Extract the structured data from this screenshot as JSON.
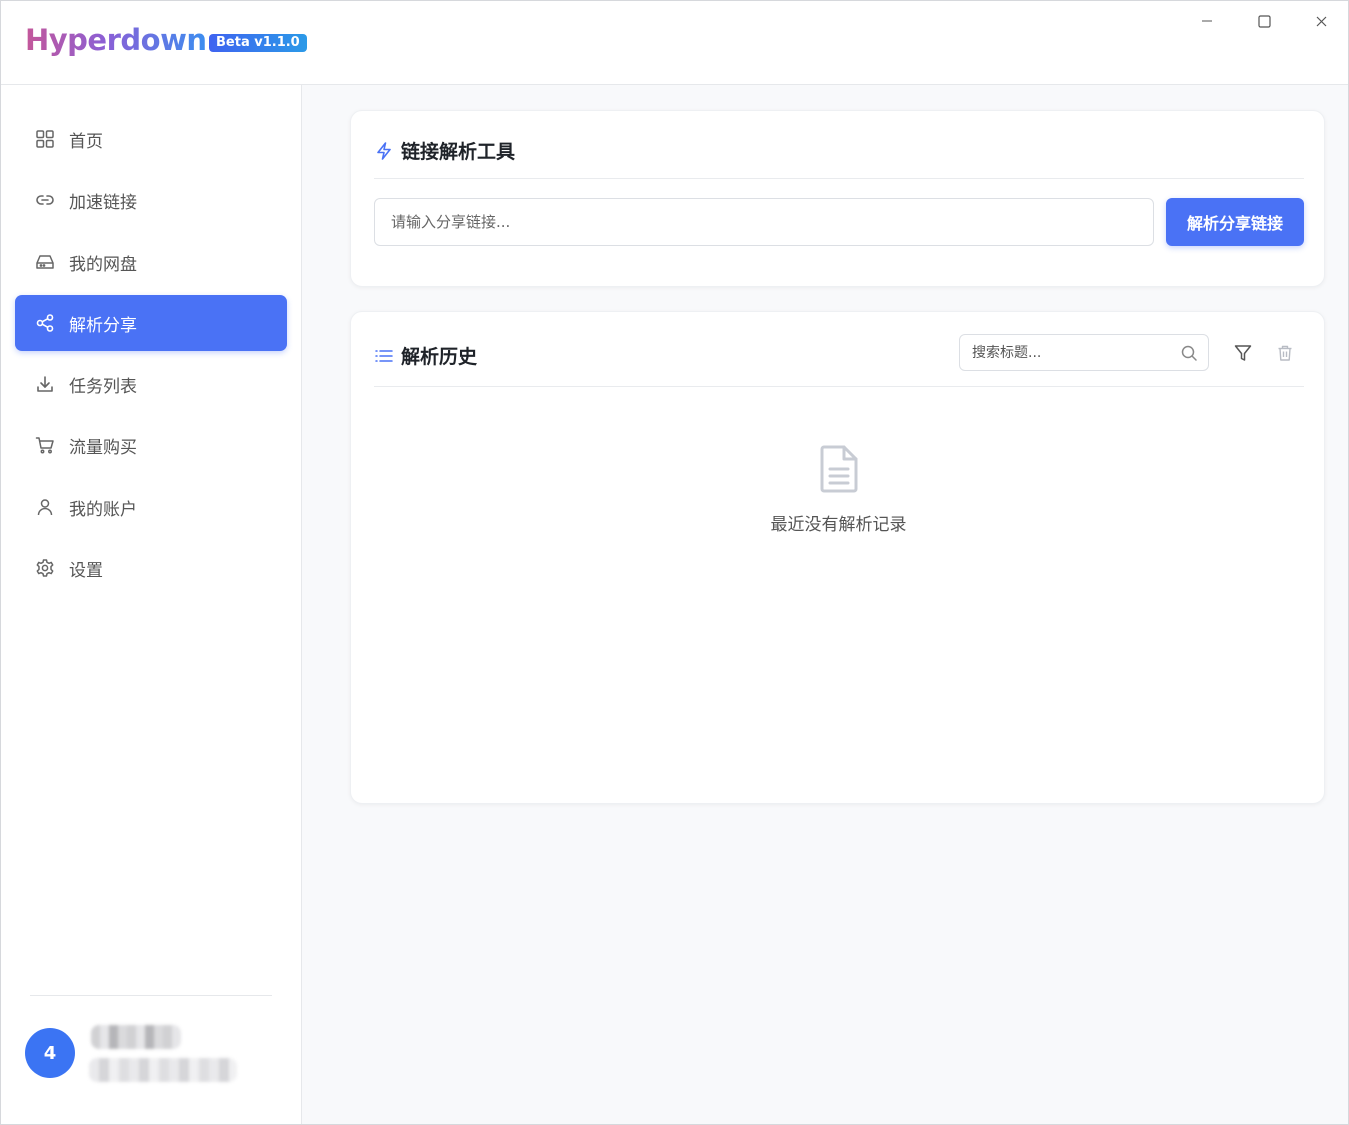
{
  "app": {
    "name": "Hyperdown",
    "version_badge": "Beta v1.1.0"
  },
  "window_controls": {
    "minimize": "minimize-icon",
    "maximize": "maximize-icon",
    "close": "close-icon"
  },
  "sidebar": {
    "items": [
      {
        "label": "首页",
        "icon": "grid-icon"
      },
      {
        "label": "加速链接",
        "icon": "link-icon"
      },
      {
        "label": "我的网盘",
        "icon": "drive-icon"
      },
      {
        "label": "解析分享",
        "icon": "share-icon",
        "active": true
      },
      {
        "label": "任务列表",
        "icon": "download-icon"
      },
      {
        "label": "流量购买",
        "icon": "cart-icon"
      },
      {
        "label": "我的账户",
        "icon": "user-icon"
      },
      {
        "label": "设置",
        "icon": "gear-icon"
      }
    ],
    "user": {
      "avatar_text": "4"
    }
  },
  "tool_card": {
    "title": "链接解析工具",
    "input_placeholder": "请输入分享链接...",
    "button_label": "解析分享链接"
  },
  "history_card": {
    "title": "解析历史",
    "search_placeholder": "搜索标题...",
    "empty_text": "最近没有解析记录"
  },
  "colors": {
    "accent": "#4a72f5",
    "avatar": "#3b74f3"
  }
}
